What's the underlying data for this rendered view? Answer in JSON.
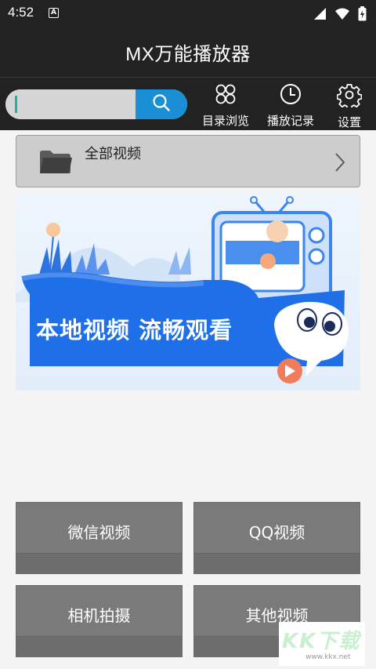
{
  "status": {
    "time": "4:52",
    "notification_icon": "A"
  },
  "app": {
    "title": "MX万能播放器"
  },
  "toolbar": {
    "search": {
      "value": "",
      "placeholder": ""
    },
    "buttons": [
      {
        "label": "目录浏览",
        "icon": "grid-icon"
      },
      {
        "label": "播放记录",
        "icon": "clock-icon"
      },
      {
        "label": "设置",
        "icon": "gear-icon"
      }
    ]
  },
  "all_videos": {
    "label": "全部视频"
  },
  "banner": {
    "slogan": "本地视频 流畅观看"
  },
  "tiles": [
    {
      "label": "微信视频"
    },
    {
      "label": "QQ视频"
    },
    {
      "label": "相机拍摄"
    },
    {
      "label": "其他视频"
    }
  ],
  "watermark": {
    "text": "KK下载",
    "url": "www.kkx.net"
  },
  "colors": {
    "bar_bg": "#222222",
    "search_accent": "#1a8fd6",
    "tile_bg": "#7a7a7a",
    "banner_blue": "#1f6fe8"
  }
}
